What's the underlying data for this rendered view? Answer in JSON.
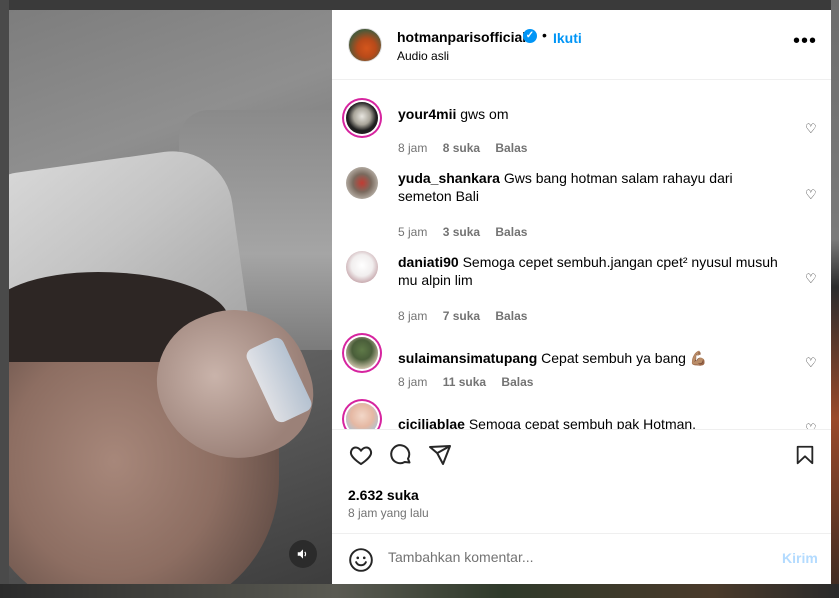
{
  "post": {
    "username": "hotmanparisofficial",
    "follow_label": "Ikuti",
    "separator": "•",
    "audio_label": "Audio asli",
    "more_icon": "more-horizontal-icon",
    "verified_icon": "verified-badge-icon"
  },
  "comments": [
    {
      "user": "your4mii",
      "text": "gws om",
      "time": "8 jam",
      "likes": "8 suka",
      "reply": "Balas"
    },
    {
      "user": "yuda_shankara",
      "text": "Gws bang hotman salam rahayu dari semeton Bali",
      "time": "5 jam",
      "likes": "3 suka",
      "reply": "Balas"
    },
    {
      "user": "daniati90",
      "text": "Semoga cepet sembuh.jangan cpet² nyusul musuh mu alpin lim",
      "time": "8 jam",
      "likes": "7 suka",
      "reply": "Balas"
    },
    {
      "user": "sulaimansimatupang",
      "text": "Cepat sembuh ya bang 💪🏽",
      "time": "8 jam",
      "likes": "11 suka",
      "reply": "Balas"
    },
    {
      "user": "ciciliablae",
      "text": "Semoga cepat sembuh pak Hotman."
    }
  ],
  "stats": {
    "likes": "2.632 suka",
    "posted": "8 jam yang lalu"
  },
  "composer": {
    "placeholder": "Tambahkan komentar...",
    "send_label": "Kirim"
  },
  "colors": {
    "accent": "#0095f6",
    "muted": "#737373",
    "story_ring": "#d6249f",
    "send_disabled": "#b3dbff"
  }
}
